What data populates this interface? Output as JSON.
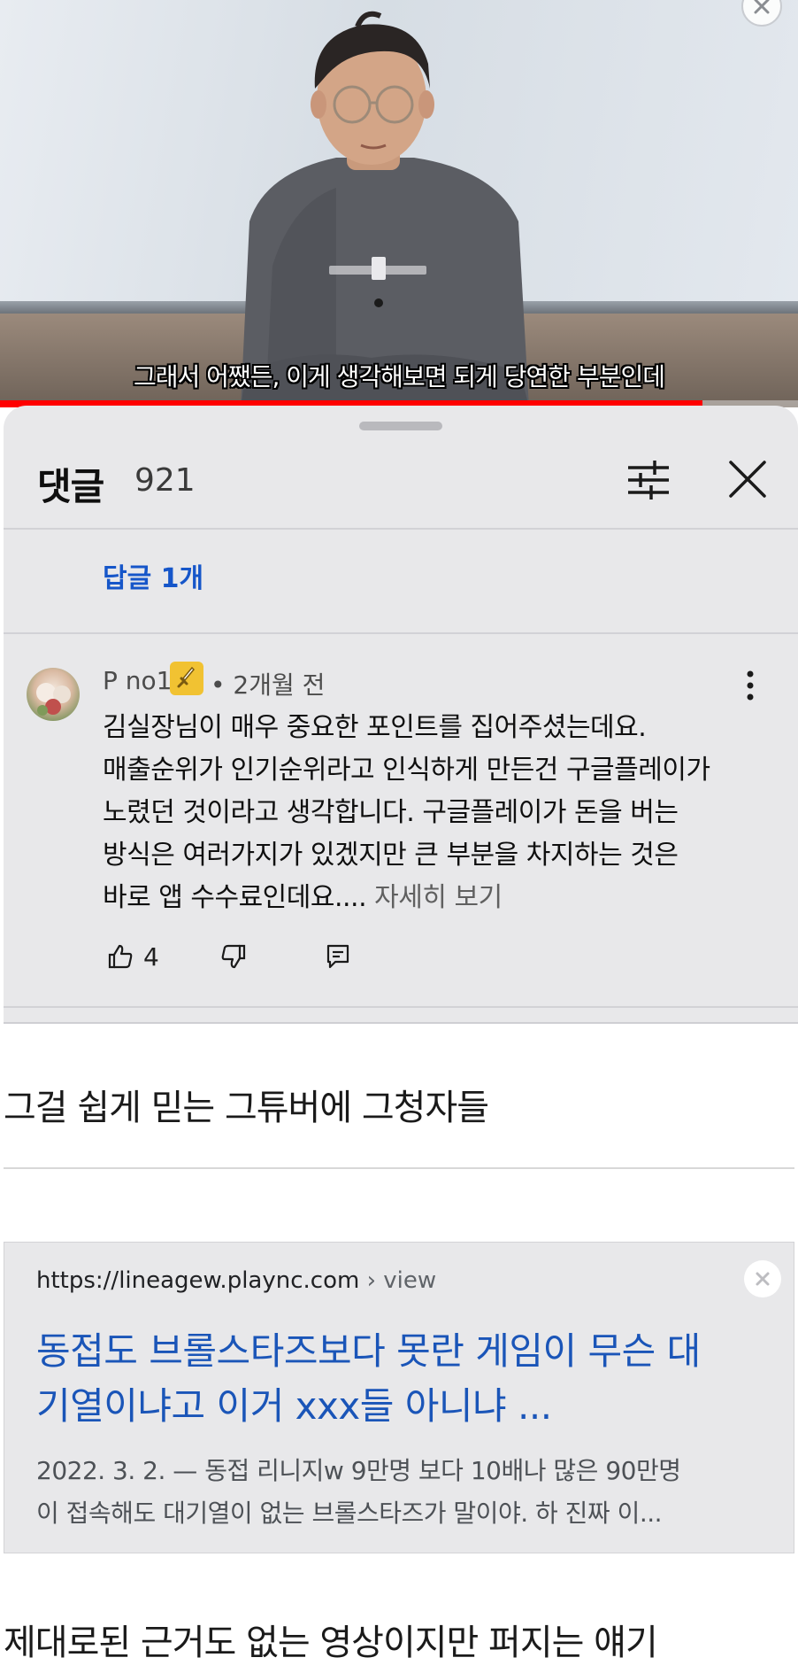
{
  "video": {
    "subtitle": "그래서 어쨌든, 이게 생각해보면 되게 당연한 부분인데",
    "progress": 0.88,
    "close_icon": "close-icon"
  },
  "comments_panel": {
    "title": "댓글",
    "count": "921",
    "filter_icon": "sliders-icon",
    "close_icon": "close-icon",
    "reply_link": "답글 1개",
    "comment": {
      "author": "P no1",
      "badge_icon": "sword-icon",
      "time": "• 2개월 전",
      "lines": [
        "김실장님이 매우 중요한 포인트를 집어주셨는데요.",
        "매출순위가 인기순위라고 인식하게 만든건 구글플레이가",
        "노렸던 것이라고 생각합니다. 구글플레이가 돈을 버는",
        "방식은 여러가지가 있겠지만 큰 부분을 차지하는 것은",
        "바로 앱 수수료인데요...."
      ],
      "more_link": "자세히 보기",
      "likes": "4"
    }
  },
  "caption_1": "그걸 쉽게 믿는 그튜버에 그청자들",
  "search_result": {
    "url": "https://lineagew.plaync.com",
    "crumb": "› view",
    "title_lines": [
      "동접도 브롤스타즈보다 못란 게임이 무슨 대",
      "기열이냐고 이거 xxx들 아니냐 ..."
    ],
    "snippet_lines": [
      "2022. 3. 2. — 동접 리니지w 9만명 보다 10배나 많은 90만명",
      "이 접속해도 대기열이 없는 브롤스타즈가 말이야. 하 진짜 이..."
    ]
  },
  "caption_2": "제대로된 근거도 없는 영상이지만 퍼지는 얘기",
  "colors": {
    "progress_red": "#ff0000",
    "link_blue": "#1656c9",
    "result_title_blue": "#1a55b8",
    "sheet_bg": "#e8e8ea"
  }
}
